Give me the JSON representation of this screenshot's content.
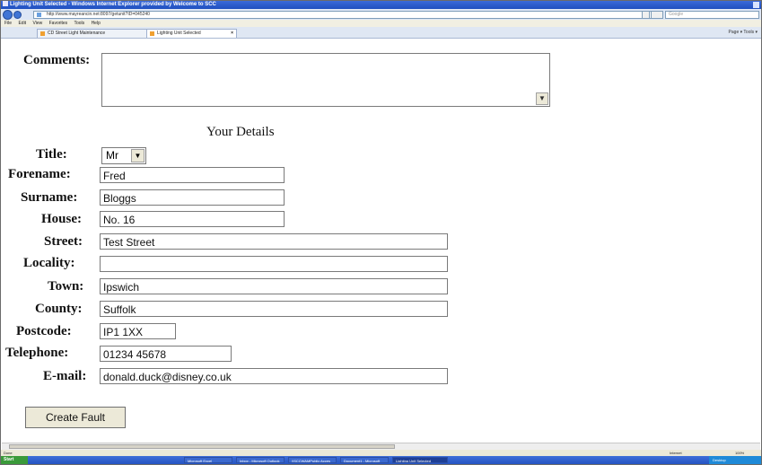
{
  "window": {
    "title": "Lighting Unit Selected - Windows Internet Explorer provided by Welcome to SCC"
  },
  "browser": {
    "url": "http://www.mayreancin.net:8097/getunit?ID=045240",
    "search_placeholder": "Google",
    "menu": [
      "File",
      "Edit",
      "View",
      "Favorites",
      "Tools",
      "Help"
    ],
    "tabs": [
      {
        "label": "CD Street Light Maintenance"
      },
      {
        "label": "Lighting Unit Selected"
      }
    ],
    "tab_tools": "Page ▾  Tools ▾"
  },
  "form": {
    "comments_label": "Comments:",
    "comments_value": "",
    "section_title": "Your Details",
    "title_label": "Title:",
    "title_value": "Mr",
    "forename_label": "Forename:",
    "forename_value": "Fred",
    "surname_label": "Surname:",
    "surname_value": "Bloggs",
    "house_label": "House:",
    "house_value": "No. 16",
    "street_label": "Street:",
    "street_value": "Test Street",
    "locality_label": "Locality:",
    "locality_value": "",
    "town_label": "Town:",
    "town_value": "Ipswich",
    "county_label": "County:",
    "county_value": "Suffolk",
    "postcode_label": "Postcode:",
    "postcode_value": "IP1 1XX",
    "telephone_label": "Telephone:",
    "telephone_value": "01234 45678",
    "email_label": "E-mail:",
    "email_value": "donald.duck@disney.co.uk",
    "submit_label": "Create Fault"
  },
  "status": {
    "text": "Done",
    "zone": "Internet",
    "zoom": "100%"
  },
  "taskbar": {
    "start": "Start",
    "items": [
      "Microsoft Excel",
      "Inbox - Microsoft Outlook",
      "\\\\SCCWAMPublic Acces",
      "Document1 - Microsoft",
      "Lighting Unit Selected"
    ],
    "tray": "Desktop"
  }
}
